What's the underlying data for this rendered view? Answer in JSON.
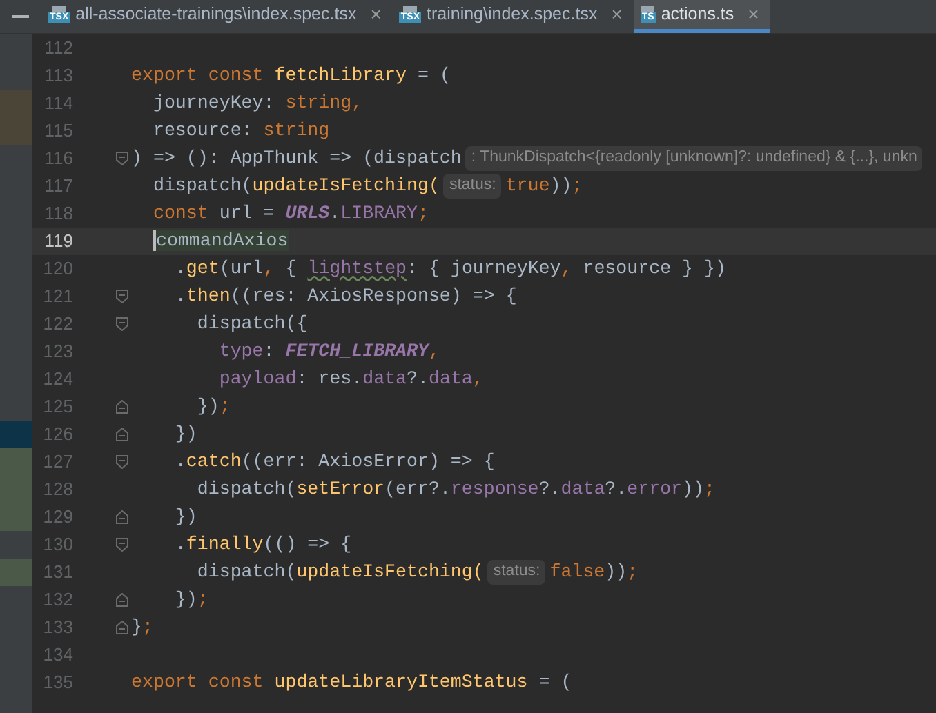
{
  "tabs": [
    {
      "badge": "TSX",
      "label": "all-associate-trainings\\index.spec.tsx",
      "close": "×",
      "selected": false
    },
    {
      "badge": "TSX",
      "label": "training\\index.spec.tsx",
      "close": "×",
      "selected": false
    },
    {
      "badge": "TS",
      "label": "actions.ts",
      "close": "×",
      "selected": true
    }
  ],
  "lines": [
    {
      "number": "112",
      "current": false,
      "kind": "plain"
    },
    {
      "number": "113",
      "current": false,
      "kind": "plain",
      "tokens": [
        {
          "kind": "kw",
          "text": "export const "
        },
        {
          "kind": "fn",
          "text": "fetchLibrary"
        },
        {
          "kind": "plain",
          "text": " = ("
        }
      ]
    },
    {
      "number": "114",
      "current": false,
      "kind": "plain",
      "color": "#4a4536",
      "tokens": [
        {
          "kind": "plain",
          "text": "  journeyKey: "
        },
        {
          "kind": "kw",
          "text": "string,"
        }
      ]
    },
    {
      "number": "115",
      "current": false,
      "kind": "plain",
      "color": "#4a4536",
      "tokens": [
        {
          "kind": "plain",
          "text": "  resource: "
        },
        {
          "kind": "kw",
          "text": "string"
        }
      ]
    },
    {
      "number": "116",
      "current": false,
      "kind": "opener",
      "tokens": [
        {
          "kind": "plain",
          "text": ") => (): AppThunk => (dispatch"
        },
        {
          "kind": "hint",
          "text": ": ThunkDispatch<{readonly [unknown]?: undefined} & {...}, unkn"
        }
      ]
    },
    {
      "number": "117",
      "current": false,
      "kind": "plain",
      "tokens": [
        {
          "kind": "plain",
          "text": "  dispatch("
        },
        {
          "kind": "fn",
          "text": "updateIsFetching("
        },
        {
          "kind": "hint",
          "text": "status:"
        },
        {
          "kind": "kw",
          "text": "true"
        },
        {
          "kind": "plain",
          "text": "))"
        },
        {
          "kind": "kw",
          "text": ";"
        }
      ]
    },
    {
      "number": "118",
      "current": false,
      "kind": "plain",
      "tokens": [
        {
          "kind": "kw",
          "text": "  const "
        },
        {
          "kind": "plain",
          "text": "url = "
        },
        {
          "kind": "const",
          "text": "URLS"
        },
        {
          "kind": "plain",
          "text": "."
        },
        {
          "kind": "prop",
          "text": "LIBRARY"
        },
        {
          "kind": "kw",
          "text": ";"
        }
      ]
    },
    {
      "number": "119",
      "current": true,
      "kind": "plain",
      "tokens": [
        {
          "kind": "match",
          "text": "  commandAxios"
        }
      ]
    },
    {
      "number": "120",
      "current": false,
      "kind": "plain",
      "tokens": [
        {
          "kind": "plain",
          "text": "    ."
        },
        {
          "kind": "fn",
          "text": "get"
        },
        {
          "kind": "plain",
          "text": "(url"
        },
        {
          "kind": "kw",
          "text": ", "
        },
        {
          "kind": "plain",
          "text": "{ "
        },
        {
          "kind": "typo",
          "text": "lightstep"
        },
        {
          "kind": "plain",
          "text": ": { journeyKey"
        },
        {
          "kind": "kw",
          "text": ", "
        },
        {
          "kind": "plain",
          "text": "resource } })"
        }
      ]
    },
    {
      "number": "121",
      "current": false,
      "kind": "opener",
      "tokens": [
        {
          "kind": "plain",
          "text": "    ."
        },
        {
          "kind": "fn",
          "text": "then"
        },
        {
          "kind": "plain",
          "text": "((res: AxiosResponse) => {"
        }
      ]
    },
    {
      "number": "122",
      "current": false,
      "kind": "opener",
      "tokens": [
        {
          "kind": "plain",
          "text": "      dispatch({"
        }
      ]
    },
    {
      "number": "123",
      "current": false,
      "kind": "plain",
      "tokens": [
        {
          "kind": "prop",
          "text": "        type"
        },
        {
          "kind": "plain",
          "text": ": "
        },
        {
          "kind": "const",
          "text": "FETCH_LIBRARY"
        },
        {
          "kind": "kw",
          "text": ","
        }
      ]
    },
    {
      "number": "124",
      "current": false,
      "kind": "plain",
      "tokens": [
        {
          "kind": "prop",
          "text": "        payload"
        },
        {
          "kind": "plain",
          "text": ": res."
        },
        {
          "kind": "prop",
          "text": "data"
        },
        {
          "kind": "plain",
          "text": "?."
        },
        {
          "kind": "prop",
          "text": "data"
        },
        {
          "kind": "kw",
          "text": ","
        }
      ]
    },
    {
      "number": "125",
      "current": false,
      "kind": "closer",
      "tokens": [
        {
          "kind": "plain",
          "text": "      })"
        },
        {
          "kind": "kw",
          "text": ";"
        }
      ]
    },
    {
      "number": "126",
      "current": false,
      "kind": "closer",
      "color": "#0d3349",
      "tokens": [
        {
          "kind": "plain",
          "text": "    })"
        }
      ]
    },
    {
      "number": "127",
      "current": false,
      "kind": "opener",
      "color": "#4b5a48",
      "tokens": [
        {
          "kind": "plain",
          "text": "    ."
        },
        {
          "kind": "fn",
          "text": "catch"
        },
        {
          "kind": "plain",
          "text": "((err: AxiosError) => {"
        }
      ]
    },
    {
      "number": "128",
      "current": false,
      "kind": "plain",
      "color": "#4b5a48",
      "tokens": [
        {
          "kind": "plain",
          "text": "      dispatch("
        },
        {
          "kind": "fn",
          "text": "setError"
        },
        {
          "kind": "plain",
          "text": "(err?."
        },
        {
          "kind": "prop",
          "text": "response"
        },
        {
          "kind": "plain",
          "text": "?."
        },
        {
          "kind": "prop",
          "text": "data"
        },
        {
          "kind": "plain",
          "text": "?."
        },
        {
          "kind": "prop",
          "text": "error"
        },
        {
          "kind": "plain",
          "text": "))"
        },
        {
          "kind": "kw",
          "text": ";"
        }
      ]
    },
    {
      "number": "129",
      "current": false,
      "kind": "closer",
      "color": "#4b5a48",
      "tokens": [
        {
          "kind": "plain",
          "text": "    })"
        }
      ]
    },
    {
      "number": "130",
      "current": false,
      "kind": "opener",
      "tokens": [
        {
          "kind": "plain",
          "text": "    ."
        },
        {
          "kind": "fn",
          "text": "finally"
        },
        {
          "kind": "plain",
          "text": "(() => {"
        }
      ]
    },
    {
      "number": "131",
      "current": false,
      "kind": "plain",
      "color": "#4b5a48",
      "tokens": [
        {
          "kind": "plain",
          "text": "      dispatch("
        },
        {
          "kind": "fn",
          "text": "updateIsFetching("
        },
        {
          "kind": "hint",
          "text": "status:"
        },
        {
          "kind": "kw",
          "text": "false"
        },
        {
          "kind": "plain",
          "text": "))"
        },
        {
          "kind": "kw",
          "text": ";"
        }
      ]
    },
    {
      "number": "132",
      "current": false,
      "kind": "closer",
      "tokens": [
        {
          "kind": "plain",
          "text": "    })"
        },
        {
          "kind": "kw",
          "text": ";"
        }
      ]
    },
    {
      "number": "133",
      "current": false,
      "kind": "closer",
      "tokens": [
        {
          "kind": "plain",
          "text": "}"
        },
        {
          "kind": "kw",
          "text": ";"
        }
      ]
    },
    {
      "number": "134",
      "current": false,
      "kind": "plain"
    },
    {
      "number": "135",
      "current": false,
      "kind": "plain",
      "tokens": [
        {
          "kind": "kw",
          "text": "export const "
        },
        {
          "kind": "fn",
          "text": "updateLibraryItemStatus"
        },
        {
          "kind": "plain",
          "text": " = ("
        }
      ]
    }
  ]
}
